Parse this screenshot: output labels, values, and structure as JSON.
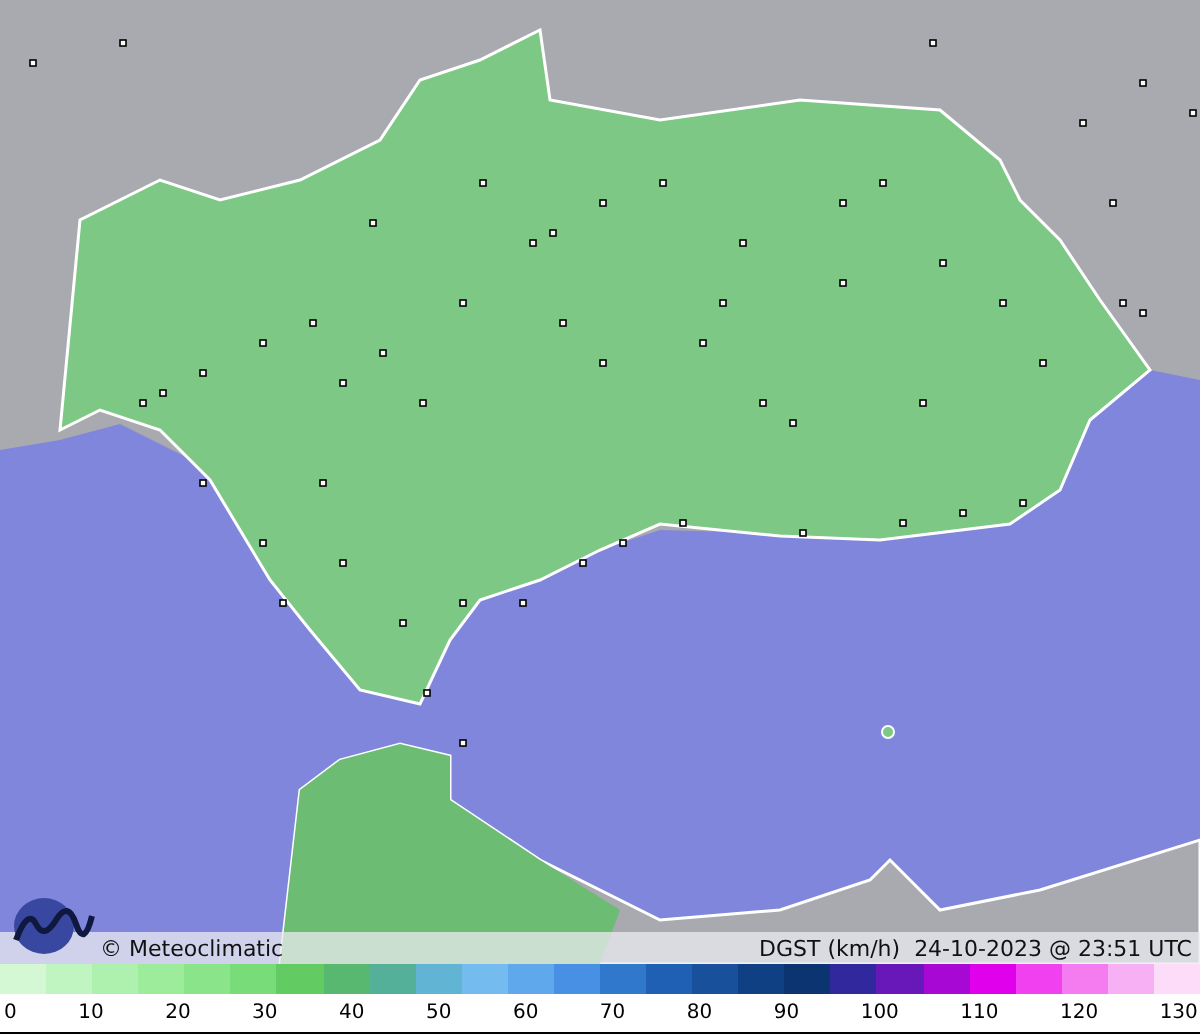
{
  "credit": "© Meteoclimatic",
  "caption": "DGST (km/h)  24-10-2023 @ 23:51 UTC",
  "legend": {
    "swatches": [
      {
        "color": "#d4f8d4"
      },
      {
        "color": "#c0f4c0"
      },
      {
        "color": "#aef0ae"
      },
      {
        "color": "#9cec9c"
      },
      {
        "color": "#8ae48a"
      },
      {
        "color": "#78dc78"
      },
      {
        "color": "#62cc62"
      },
      {
        "color": "#58b870"
      },
      {
        "color": "#54b098"
      },
      {
        "color": "#62b4d4"
      },
      {
        "color": "#74bcf0"
      },
      {
        "color": "#60a8ec"
      },
      {
        "color": "#4890e4"
      },
      {
        "color": "#3078cc"
      },
      {
        "color": "#2060b4"
      },
      {
        "color": "#18509c"
      },
      {
        "color": "#104084"
      },
      {
        "color": "#0c3470"
      },
      {
        "color": "#30289c"
      },
      {
        "color": "#6818b8"
      },
      {
        "color": "#a808d4"
      },
      {
        "color": "#e000ec"
      },
      {
        "color": "#f040f0"
      },
      {
        "color": "#f47cf0"
      },
      {
        "color": "#f8b0f4"
      },
      {
        "color": "#fcdcf8"
      }
    ],
    "ticks": [
      "0",
      "10",
      "20",
      "30",
      "40",
      "50",
      "60",
      "70",
      "80",
      "90",
      "100",
      "110",
      "120",
      "130"
    ]
  }
}
